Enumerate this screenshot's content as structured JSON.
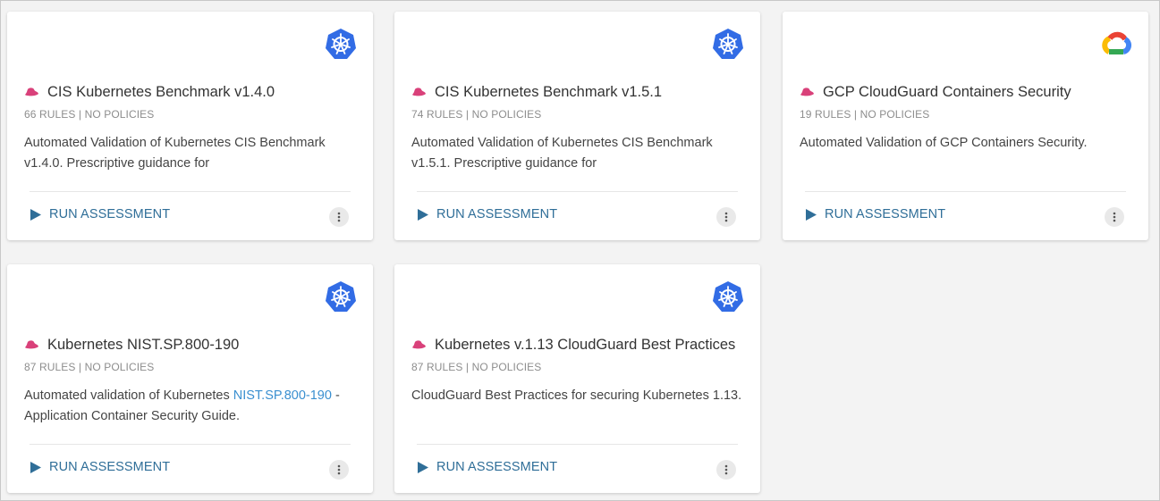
{
  "cards": [
    {
      "icon": "kubernetes-icon",
      "title": "CIS Kubernetes Benchmark v1.4.0",
      "meta": "66 RULES | NO POLICIES",
      "desc_before": "Automated Validation of Kubernetes CIS Benchmark v1.4.0. Prescriptive guidance for",
      "desc_link": "",
      "desc_after": "",
      "run_label": "RUN ASSESSMENT"
    },
    {
      "icon": "kubernetes-icon",
      "title": "CIS Kubernetes Benchmark v1.5.1",
      "meta": "74 RULES | NO POLICIES",
      "desc_before": "Automated Validation of Kubernetes CIS Benchmark v1.5.1. Prescriptive guidance for",
      "desc_link": "",
      "desc_after": "",
      "run_label": "RUN ASSESSMENT"
    },
    {
      "icon": "google-cloud-icon",
      "title": "GCP CloudGuard Containers Security",
      "meta": "19 RULES | NO POLICIES",
      "desc_before": "Automated Validation of GCP Containers Security.",
      "desc_link": "",
      "desc_after": "",
      "run_label": "RUN ASSESSMENT"
    },
    {
      "icon": "kubernetes-icon",
      "title": "Kubernetes NIST.SP.800-190",
      "meta": "87 RULES | NO POLICIES",
      "desc_before": "Automated validation of Kubernetes ",
      "desc_link": "NIST.SP.800-190",
      "desc_after": " - Application Container Security Guide.",
      "run_label": "RUN ASSESSMENT"
    },
    {
      "icon": "kubernetes-icon",
      "title": "Kubernetes v.1.13 CloudGuard Best Practices",
      "meta": "87 RULES | NO POLICIES",
      "desc_before": "CloudGuard Best Practices for securing Kubernetes 1.13.",
      "desc_link": "",
      "desc_after": "",
      "run_label": "RUN ASSESSMENT"
    }
  ],
  "colors": {
    "kubernetes_blue": "#326ce5",
    "hat_pink": "#d9417a",
    "run_blue": "#2f6e98",
    "link_blue": "#3a8fd0"
  }
}
